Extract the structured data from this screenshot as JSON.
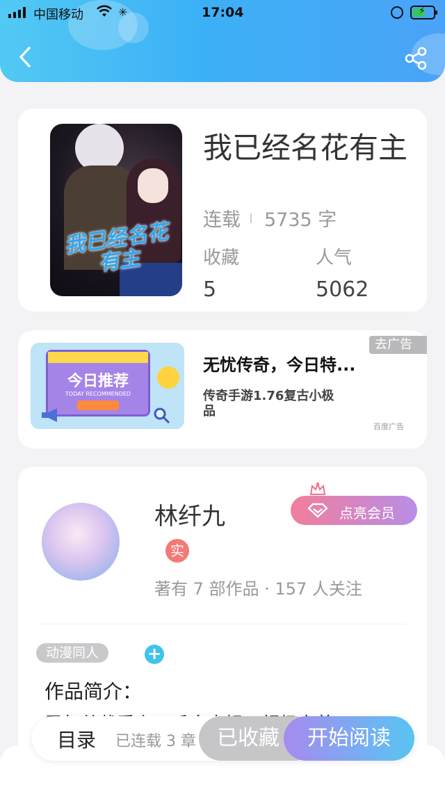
{
  "status_bar": {
    "carrier": "中国移动",
    "time": "17:04",
    "battery_level": 0.6
  },
  "header": {
    "back_icon": "chevron-left-icon",
    "share_icon": "share-icon"
  },
  "book": {
    "title": "我已经名花有主",
    "cover_title": "我已经名花有主",
    "status": "连载",
    "word_count": "5735 字",
    "favorites_label": "收藏",
    "favorites_value": "5",
    "popularity_label": "人气",
    "popularity_value": "5062"
  },
  "ad": {
    "image_text": "今日推荐",
    "image_subtext": "TODAY RECOMMENDED",
    "title": "无忧传奇，今日特...",
    "description": "传奇手游1.76复古小极品",
    "close_label": "去广告",
    "source": "百度广告"
  },
  "author": {
    "name": "林纤九",
    "vip_button": "点亮会员",
    "real_badge": "实",
    "works_info": "著有 7 部作品 · 157 人关注",
    "tag": "动漫同人",
    "tag_add": "+",
    "intro_label": "作品简介：",
    "intro_text": "霸气总裁爱上了千金大姐，超级宠养"
  },
  "bottom_bar": {
    "toc": "目录",
    "serial_info": "已连载 3 章",
    "favorited_button": "已收藏",
    "read_button": "开始阅读"
  },
  "colors": {
    "header_start": "#52c9f4",
    "header_end": "#4aa3f8",
    "vip_gradient_start": "#f27d9c",
    "vip_gradient_end": "#b88ee6",
    "read_gradient_start": "#a78af0",
    "read_gradient_end": "#58c5f2"
  }
}
